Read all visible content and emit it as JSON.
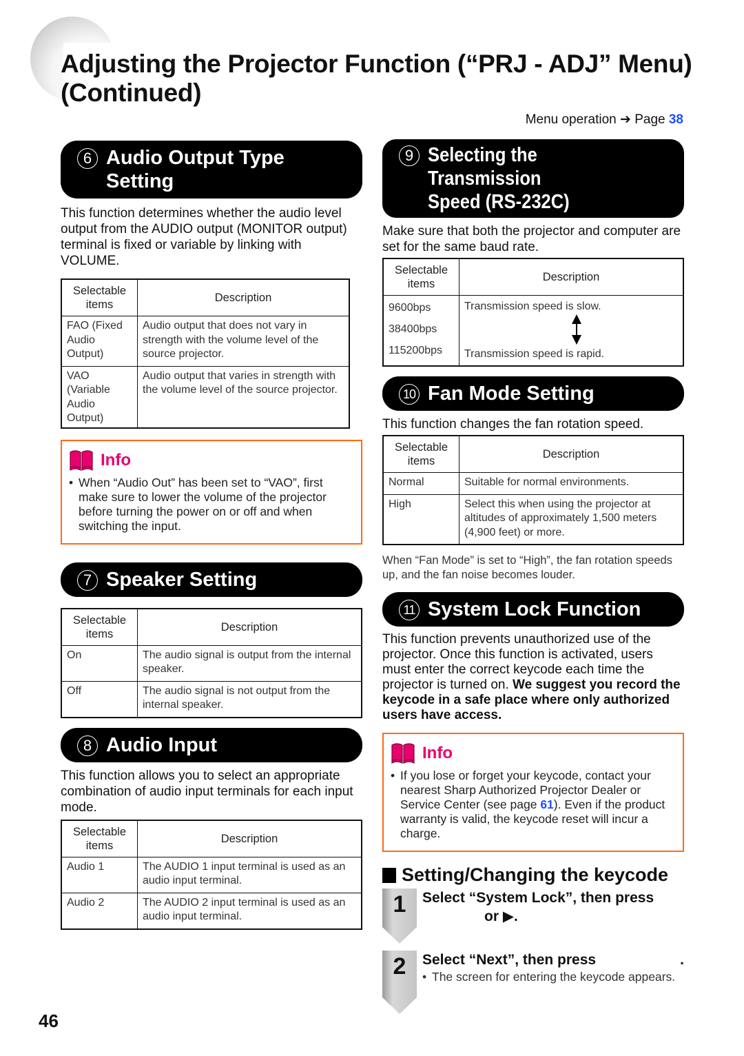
{
  "header": {
    "title": "Adjusting the Projector Function (“PRJ - ADJ” Menu) (Continued)",
    "menu_operation_label": "Menu operation ➔ Page",
    "menu_operation_page": "38"
  },
  "sections": {
    "audio_output": {
      "number": "6",
      "title": "Audio Output Type Setting",
      "description": "This function determines whether the audio level output from the AUDIO output (MONITOR output) terminal is fixed or variable by linking with VOLUME.",
      "table": {
        "headers": [
          "Selectable items",
          "Description"
        ],
        "rows": [
          {
            "item": "FAO (Fixed Audio Output)",
            "description": "Audio output that does not vary in strength with the volume level of the source projector."
          },
          {
            "item": "VAO (Variable Audio Output)",
            "description": "Audio output that varies in strength with the volume level of the source projector."
          }
        ]
      },
      "info": {
        "label": "Info",
        "text": "When “Audio Out” has been set to “VAO”, first make sure to lower the volume of the projector before turning the power on or off and when switching the input."
      }
    },
    "speaker": {
      "number": "7",
      "title": "Speaker Setting",
      "table": {
        "headers": [
          "Selectable items",
          "Description"
        ],
        "rows": [
          {
            "item": "On",
            "description": "The audio signal is output from the internal speaker."
          },
          {
            "item": "Off",
            "description": "The audio signal is not output from the internal speaker."
          }
        ]
      }
    },
    "audio_input": {
      "number": "8",
      "title": "Audio Input",
      "description": "This function allows you to select an appropriate combination of audio input terminals for each input mode.",
      "table": {
        "headers": [
          "Selectable items",
          "Description"
        ],
        "rows": [
          {
            "item": "Audio 1",
            "description": "The AUDIO 1 input terminal is used as an audio input terminal."
          },
          {
            "item": "Audio 2",
            "description": "The AUDIO 2 input terminal is used as an audio input terminal."
          }
        ]
      }
    },
    "transmission": {
      "number": "9",
      "title_line1": "Selecting the Transmission",
      "title_line2": "Speed (RS-232C)",
      "description": "Make sure that both the projector and computer are set for the same baud rate.",
      "table": {
        "headers": [
          "Selectable items",
          "Description"
        ],
        "items": [
          "9600bps",
          "38400bps",
          "115200bps"
        ],
        "desc_slow": "Transmission speed is slow.",
        "desc_rapid": "Transmission speed is rapid."
      }
    },
    "fan_mode": {
      "number": "10",
      "title": "Fan Mode Setting",
      "description": "This function changes the fan rotation speed.",
      "table": {
        "headers": [
          "Selectable items",
          "Description"
        ],
        "rows": [
          {
            "item": "Normal",
            "description": "Suitable for normal environments."
          },
          {
            "item": "High",
            "description": "Select this when using the projector at altitudes of approximately 1,500 meters (4,900 feet) or more."
          }
        ]
      },
      "note": "When “Fan Mode” is set to “High”, the fan rotation speeds up, and the fan noise becomes louder."
    },
    "system_lock": {
      "number": "11",
      "title": "System Lock Function",
      "description_plain": "This function prevents unauthorized use of the projector. Once this function is activated, users must enter the correct keycode each time the projector is turned on.",
      "description_bold": "We suggest you record the keycode in a safe place where only authorized users have access.",
      "info": {
        "label": "Info",
        "text_before": "If you lose or forget your keycode, contact your nearest Sharp Authorized Projector Dealer or Service Center (see page",
        "page_link": "61",
        "text_after": "). Even if the product warranty is valid, the keycode reset will incur a charge."
      },
      "keycode": {
        "heading": "Setting/Changing the keycode",
        "steps": [
          {
            "number": "1",
            "title_line1": "Select “System Lock”, then press",
            "title_line2": "or ▶."
          },
          {
            "number": "2",
            "title": "Select “Next”, then press",
            "title_end": ".",
            "note": "The screen for entering the keycode appears."
          }
        ]
      }
    }
  },
  "footer": {
    "page_number": "46"
  },
  "colors": {
    "accent_blue": "#1f4fff",
    "info_pink": "#e8006e",
    "info_border": "#ff6a12"
  }
}
